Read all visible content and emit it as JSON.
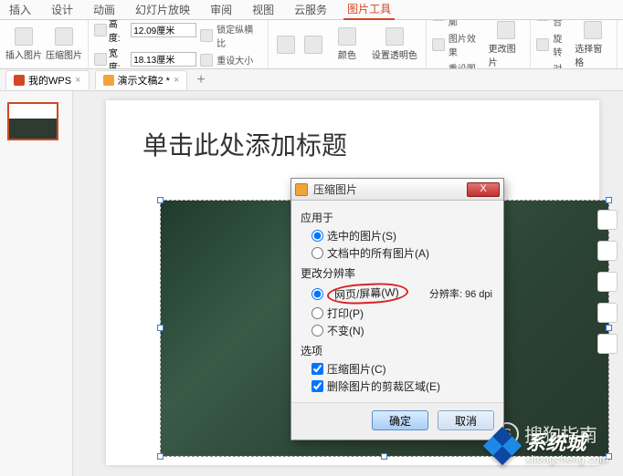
{
  "menubar": {
    "tabs": [
      "插入",
      "设计",
      "动画",
      "幻灯片放映",
      "审阅",
      "视图",
      "云服务",
      "图片工具"
    ],
    "activeIndex": 7
  },
  "ribbon": {
    "insert_pic": "插入图片",
    "compress_pic": "压缩图片",
    "height_label": "高度:",
    "height_value": "12.09厘米",
    "width_label": "宽度:",
    "width_value": "18.13厘米",
    "lock_ratio": "锁定纵横比",
    "reset_size": "重设大小",
    "set_transparent": "设置透明色",
    "color": "颜色",
    "pic_outline": "图片轮廓",
    "pic_effect": "图片效果",
    "reset_pic": "重设图片",
    "change_pic": "更改图片",
    "group": "组合",
    "rotate": "旋转",
    "align": "对齐",
    "select_pane": "选择窗格"
  },
  "doctabs": {
    "tab1": "我的WPS",
    "tab2": "演示文稿2 *"
  },
  "slide": {
    "title_placeholder": "单击此处添加标题",
    "sogou_text": "搜狗指南"
  },
  "dialog": {
    "title": "压缩图片",
    "section_apply": "应用于",
    "opt_selected": "选中的图片(S)",
    "opt_all": "文档中的所有图片(A)",
    "section_res": "更改分辨率",
    "opt_web": "网页/屏幕(W)",
    "opt_print": "打印(P)",
    "opt_nochange": "不变(N)",
    "res_label": "分辨率:",
    "res_value": "96 dpi",
    "section_options": "选项",
    "opt_compress": "压缩图片(C)",
    "opt_crop": "删除图片的剪裁区域(E)",
    "btn_ok": "确定",
    "btn_cancel": "取消"
  },
  "watermark": {
    "text": "系统城",
    "sub": "xitongcheng.com"
  }
}
